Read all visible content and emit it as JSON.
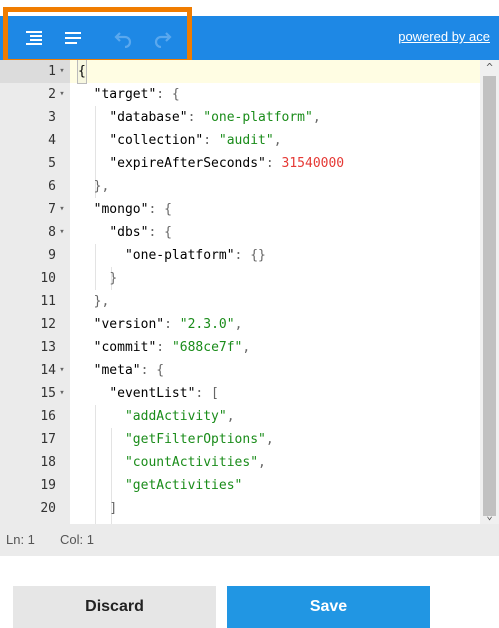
{
  "toolbar": {
    "buttons": [
      {
        "name": "format-icon",
        "title": "Format"
      },
      {
        "name": "compact-icon",
        "title": "Compact"
      },
      {
        "name": "undo-icon",
        "title": "Undo"
      },
      {
        "name": "redo-icon",
        "title": "Redo"
      }
    ],
    "powered_by": "powered by ace"
  },
  "colors": {
    "toolbar_bg": "#1e88e5",
    "highlight": "#f07c00",
    "string": "#1a8c1a",
    "number": "#e53935",
    "save_button": "#2196e3"
  },
  "editor": {
    "lines": [
      {
        "num": "1",
        "fold": true,
        "tokens": [
          {
            "t": "{",
            "c": "cursor"
          }
        ]
      },
      {
        "num": "2",
        "fold": true,
        "tokens": [
          {
            "t": "  "
          },
          {
            "t": "\"target\"",
            "c": "key"
          },
          {
            "t": ": {",
            "c": "punc"
          }
        ]
      },
      {
        "num": "3",
        "fold": false,
        "tokens": [
          {
            "t": "    "
          },
          {
            "t": "\"database\"",
            "c": "key"
          },
          {
            "t": ": ",
            "c": "punc"
          },
          {
            "t": "\"one-platform\"",
            "c": "str"
          },
          {
            "t": ",",
            "c": "punc"
          }
        ]
      },
      {
        "num": "4",
        "fold": false,
        "tokens": [
          {
            "t": "    "
          },
          {
            "t": "\"collection\"",
            "c": "key"
          },
          {
            "t": ": ",
            "c": "punc"
          },
          {
            "t": "\"audit\"",
            "c": "str"
          },
          {
            "t": ",",
            "c": "punc"
          }
        ]
      },
      {
        "num": "5",
        "fold": false,
        "tokens": [
          {
            "t": "    "
          },
          {
            "t": "\"expireAfterSeconds\"",
            "c": "key"
          },
          {
            "t": ": ",
            "c": "punc"
          },
          {
            "t": "31540000",
            "c": "num"
          }
        ]
      },
      {
        "num": "6",
        "fold": false,
        "tokens": [
          {
            "t": "  "
          },
          {
            "t": "},",
            "c": "punc"
          }
        ]
      },
      {
        "num": "7",
        "fold": true,
        "tokens": [
          {
            "t": "  "
          },
          {
            "t": "\"mongo\"",
            "c": "key"
          },
          {
            "t": ": {",
            "c": "punc"
          }
        ]
      },
      {
        "num": "8",
        "fold": true,
        "tokens": [
          {
            "t": "    "
          },
          {
            "t": "\"dbs\"",
            "c": "key"
          },
          {
            "t": ": {",
            "c": "punc"
          }
        ]
      },
      {
        "num": "9",
        "fold": false,
        "tokens": [
          {
            "t": "      "
          },
          {
            "t": "\"one-platform\"",
            "c": "key"
          },
          {
            "t": ": {}",
            "c": "punc"
          }
        ]
      },
      {
        "num": "10",
        "fold": false,
        "tokens": [
          {
            "t": "    "
          },
          {
            "t": "}",
            "c": "punc"
          }
        ]
      },
      {
        "num": "11",
        "fold": false,
        "tokens": [
          {
            "t": "  "
          },
          {
            "t": "},",
            "c": "punc"
          }
        ]
      },
      {
        "num": "12",
        "fold": false,
        "tokens": [
          {
            "t": "  "
          },
          {
            "t": "\"version\"",
            "c": "key"
          },
          {
            "t": ": ",
            "c": "punc"
          },
          {
            "t": "\"2.3.0\"",
            "c": "str"
          },
          {
            "t": ",",
            "c": "punc"
          }
        ]
      },
      {
        "num": "13",
        "fold": false,
        "tokens": [
          {
            "t": "  "
          },
          {
            "t": "\"commit\"",
            "c": "key"
          },
          {
            "t": ": ",
            "c": "punc"
          },
          {
            "t": "\"688ce7f\"",
            "c": "str"
          },
          {
            "t": ",",
            "c": "punc"
          }
        ]
      },
      {
        "num": "14",
        "fold": true,
        "tokens": [
          {
            "t": "  "
          },
          {
            "t": "\"meta\"",
            "c": "key"
          },
          {
            "t": ": {",
            "c": "punc"
          }
        ]
      },
      {
        "num": "15",
        "fold": true,
        "tokens": [
          {
            "t": "    "
          },
          {
            "t": "\"eventList\"",
            "c": "key"
          },
          {
            "t": ": [",
            "c": "punc"
          }
        ]
      },
      {
        "num": "16",
        "fold": false,
        "tokens": [
          {
            "t": "      "
          },
          {
            "t": "\"addActivity\"",
            "c": "str"
          },
          {
            "t": ",",
            "c": "punc"
          }
        ]
      },
      {
        "num": "17",
        "fold": false,
        "tokens": [
          {
            "t": "      "
          },
          {
            "t": "\"getFilterOptions\"",
            "c": "str"
          },
          {
            "t": ",",
            "c": "punc"
          }
        ]
      },
      {
        "num": "18",
        "fold": false,
        "tokens": [
          {
            "t": "      "
          },
          {
            "t": "\"countActivities\"",
            "c": "str"
          },
          {
            "t": ",",
            "c": "punc"
          }
        ]
      },
      {
        "num": "19",
        "fold": false,
        "tokens": [
          {
            "t": "      "
          },
          {
            "t": "\"getActivities\"",
            "c": "str"
          }
        ]
      },
      {
        "num": "20",
        "fold": false,
        "tokens": [
          {
            "t": "    "
          },
          {
            "t": "]",
            "c": "punc"
          }
        ]
      }
    ]
  },
  "status": {
    "line": "Ln: 1",
    "col": "Col: 1"
  },
  "actions": {
    "discard_label": "Discard",
    "save_label": "Save"
  }
}
